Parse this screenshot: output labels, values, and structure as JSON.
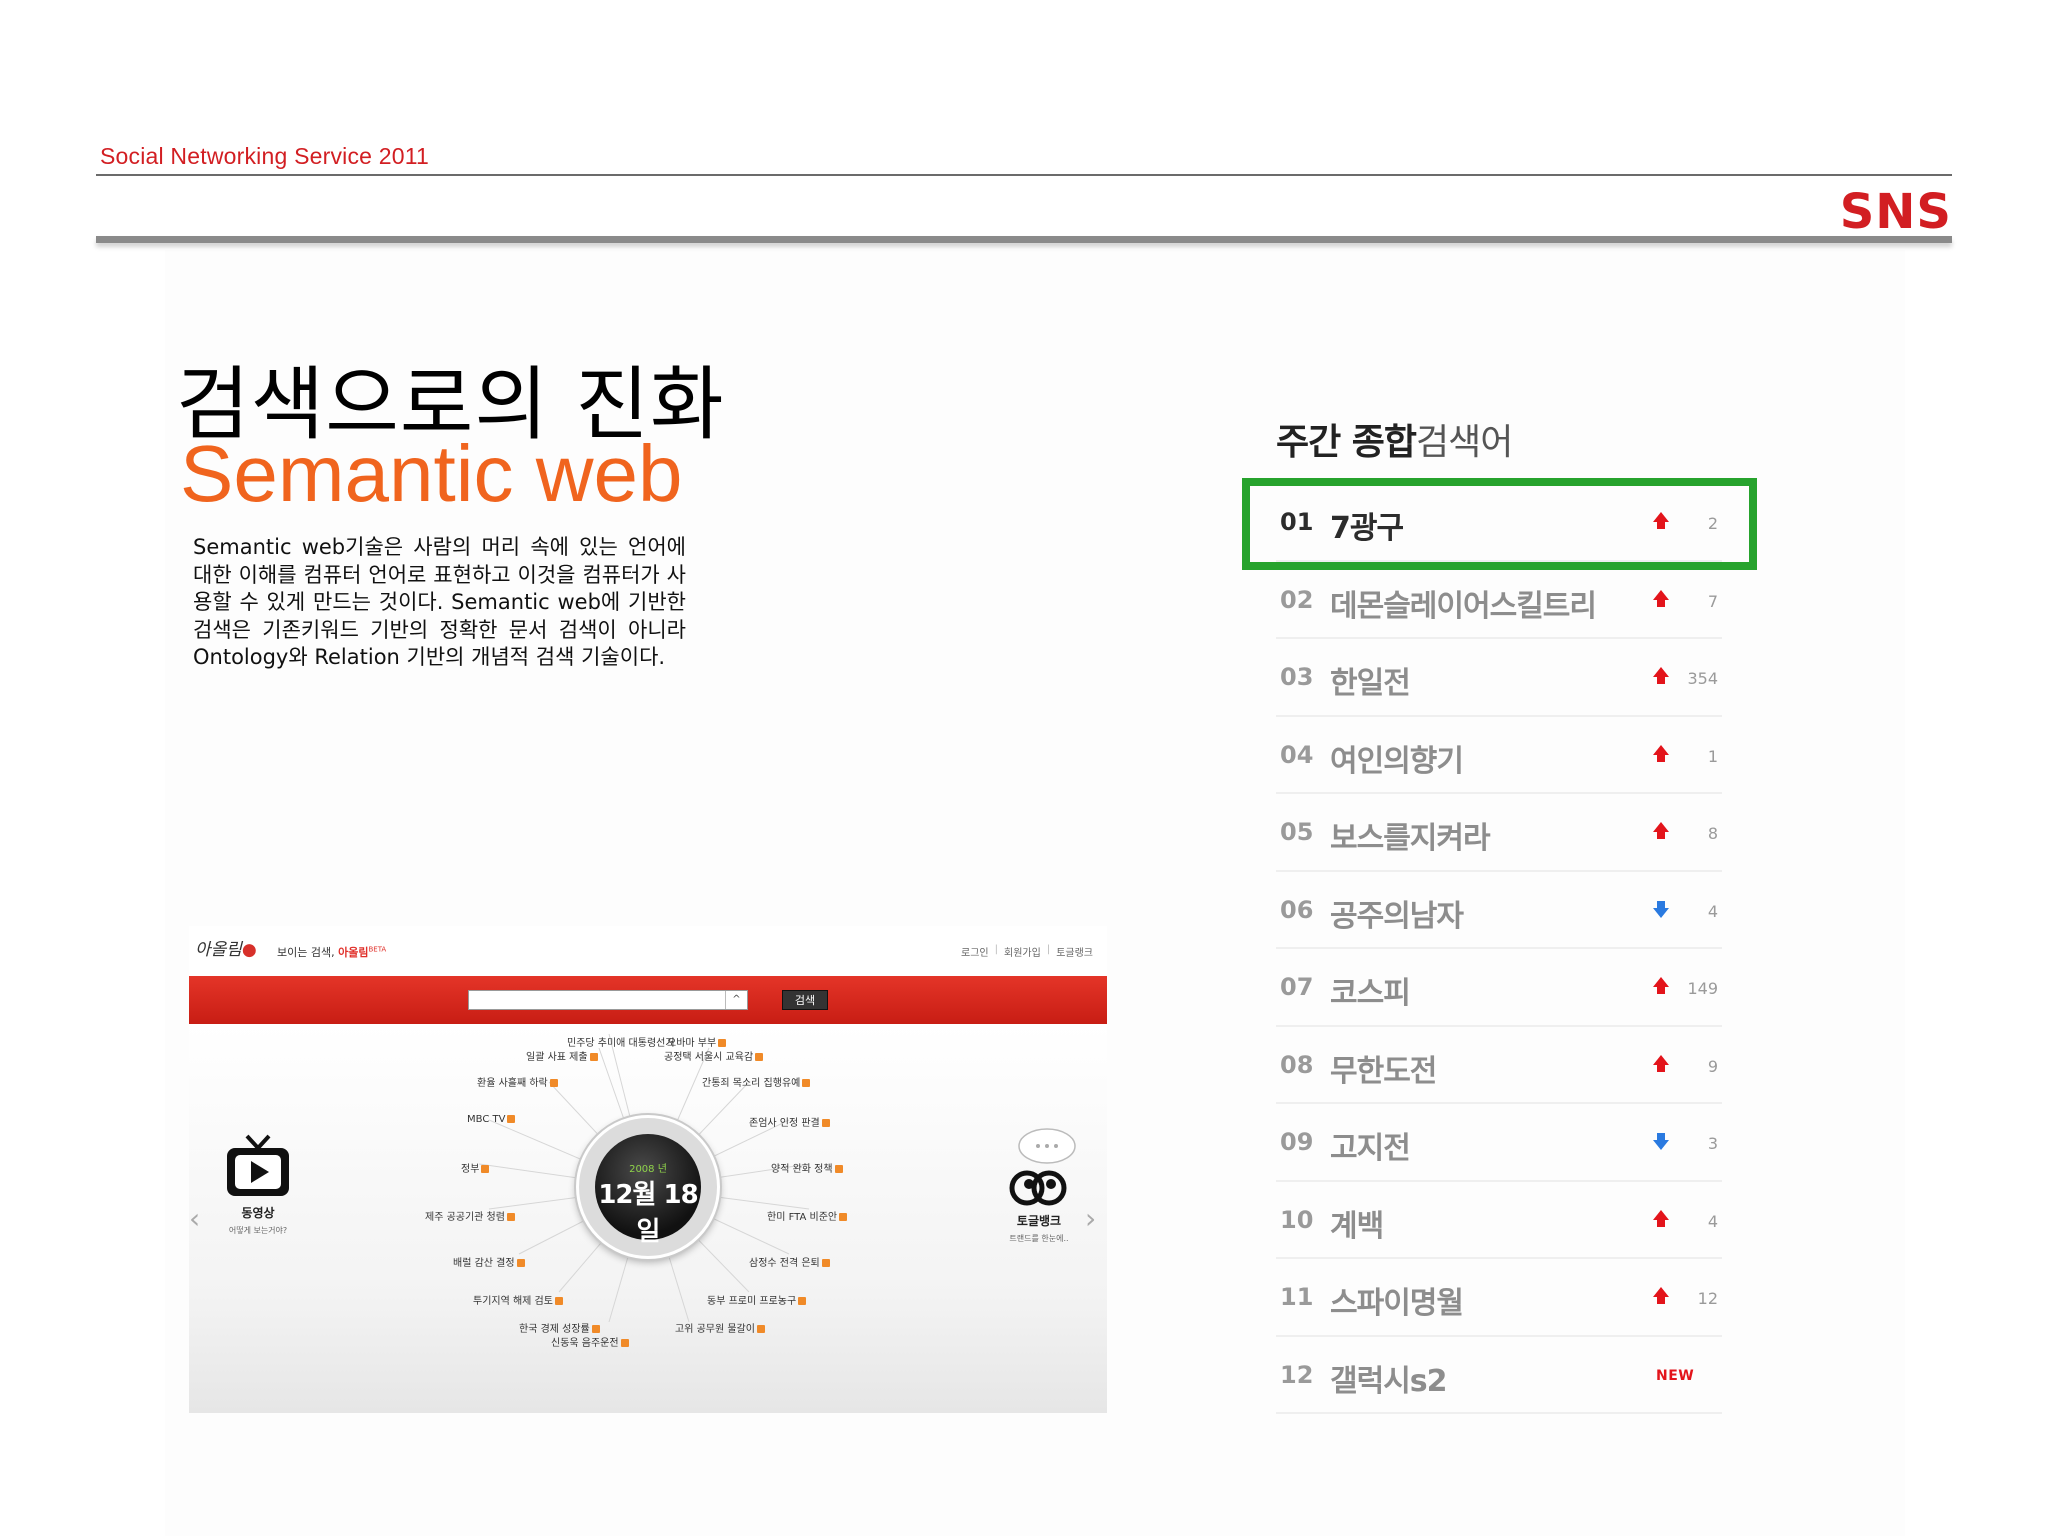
{
  "header": {
    "title": "Social Networking Service 2011",
    "badge": "SNS",
    "colors": {
      "accent": "#d21e22",
      "rule": "#8a8a8a"
    }
  },
  "intro": {
    "heading_kr": "검색으로의 진화",
    "heading_en": "Semantic web",
    "description": "Semantic web기술은 사람의 머리 속에 있는 언어에 대한 이해를 컴퓨터 언어로 표현하고 이것을 컴퓨터가 사용할 수 있게 만드는 것이다. Semantic web에 기반한 검색은 기존키워드 기반의 정확한 문서 검색이 아니라 Ontology와 Relation 기반의 개념적 검색 기술이다.",
    "colors": {
      "heading_en": "#f0641e"
    }
  },
  "screenshot": {
    "logo_text": "아올림",
    "slogan": "보이는 검색,",
    "slogan_brand": "아올림",
    "slogan_tag": "BETA",
    "top_links": [
      "로그인",
      "회원가입",
      "토글랭크"
    ],
    "search_button": "검색",
    "search_arrow": "^",
    "clock_year": "2008 년",
    "clock_date": "12월 18일",
    "left_panel": {
      "title": "동영상",
      "subtitle": "어떻게 보는거야?"
    },
    "right_panel": {
      "title": "토글뱅크",
      "subtitle": "트랜드를 한눈에.."
    },
    "nav_left": "‹",
    "nav_right": "›",
    "keywords": [
      "민주당 추미애 대통령선거",
      "오바마 부부",
      "일괄 사표 제출",
      "공정택 서울시 교육감",
      "환율 사흘째 하락",
      "간통죄 목소리 집행유예",
      "MBC TV",
      "존엄사 인정 판결",
      "정부",
      "양적 완화 정책",
      "제주 공공기관 청렴",
      "한미 FTA 비준안",
      "배럴 감산 결정",
      "삼정수 전격 은퇴",
      "투기지역 해제 검토",
      "동부 프로미 프로농구",
      "한국 경제 성장률",
      "고위 공무원 물갈이",
      "신동욱 음주운전"
    ],
    "colors": {
      "bar": "#d9281d",
      "date_year": "#8fd24a"
    }
  },
  "ranking": {
    "title_bold": "주간 종합",
    "title_light": "검색어",
    "items": [
      {
        "rank": "01",
        "keyword": "7광구",
        "trend": "up",
        "change": "2"
      },
      {
        "rank": "02",
        "keyword": "데몬슬레이어스킬트리",
        "trend": "up",
        "change": "7"
      },
      {
        "rank": "03",
        "keyword": "한일전",
        "trend": "up",
        "change": "354"
      },
      {
        "rank": "04",
        "keyword": "여인의향기",
        "trend": "up",
        "change": "1"
      },
      {
        "rank": "05",
        "keyword": "보스를지켜라",
        "trend": "up",
        "change": "8"
      },
      {
        "rank": "06",
        "keyword": "공주의남자",
        "trend": "down",
        "change": "4"
      },
      {
        "rank": "07",
        "keyword": "코스피",
        "trend": "up",
        "change": "149"
      },
      {
        "rank": "08",
        "keyword": "무한도전",
        "trend": "up",
        "change": "9"
      },
      {
        "rank": "09",
        "keyword": "고지전",
        "trend": "down",
        "change": "3"
      },
      {
        "rank": "10",
        "keyword": "계백",
        "trend": "up",
        "change": "4"
      },
      {
        "rank": "11",
        "keyword": "스파이명월",
        "trend": "up",
        "change": "12"
      },
      {
        "rank": "12",
        "keyword": "갤럭시s2",
        "trend": "new",
        "change": "NEW"
      }
    ],
    "colors": {
      "up": "#e3141b",
      "down": "#2a7ae0",
      "highlight": "#27a32d"
    }
  }
}
